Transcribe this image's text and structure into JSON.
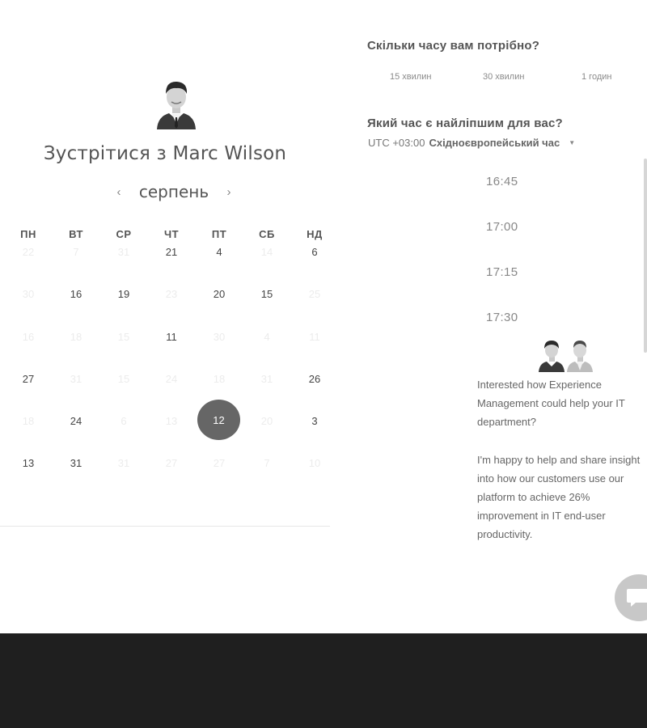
{
  "calendar": {
    "title": "Зустрітися з Marc Wilson",
    "month": "серпень",
    "prev_icon": "chevron-left-icon",
    "next_icon": "chevron-right-icon",
    "weekdays": [
      "ПН",
      "ВТ",
      "СР",
      "ЧТ",
      "ПТ",
      "СБ",
      "НД"
    ],
    "selected_day": "12",
    "rows": [
      [
        {
          "t": "22",
          "a": false
        },
        {
          "t": "7",
          "a": false
        },
        {
          "t": "31",
          "a": false
        },
        {
          "t": "21",
          "a": true
        },
        {
          "t": "4",
          "a": true
        },
        {
          "t": "14",
          "a": false
        },
        {
          "t": "6",
          "a": true
        }
      ],
      [
        {
          "t": "30",
          "a": false
        },
        {
          "t": "16",
          "a": true
        },
        {
          "t": "19",
          "a": true
        },
        {
          "t": "23",
          "a": false
        },
        {
          "t": "20",
          "a": true
        },
        {
          "t": "15",
          "a": true
        },
        {
          "t": "25",
          "a": false
        }
      ],
      [
        {
          "t": "16",
          "a": false
        },
        {
          "t": "18",
          "a": false
        },
        {
          "t": "15",
          "a": false
        },
        {
          "t": "11",
          "a": true
        },
        {
          "t": "30",
          "a": false
        },
        {
          "t": "4",
          "a": false
        },
        {
          "t": "11",
          "a": false
        }
      ],
      [
        {
          "t": "27",
          "a": true
        },
        {
          "t": "31",
          "a": false
        },
        {
          "t": "15",
          "a": false
        },
        {
          "t": "24",
          "a": false
        },
        {
          "t": "18",
          "a": false
        },
        {
          "t": "31",
          "a": false
        },
        {
          "t": "26",
          "a": true
        }
      ],
      [
        {
          "t": "18",
          "a": false
        },
        {
          "t": "24",
          "a": true
        },
        {
          "t": "6",
          "a": false
        },
        {
          "t": "13",
          "a": false
        },
        {
          "t": "12",
          "a": true,
          "sel": true
        },
        {
          "t": "20",
          "a": false
        },
        {
          "t": "3",
          "a": true
        }
      ],
      [
        {
          "t": "13",
          "a": true
        },
        {
          "t": "31",
          "a": true
        },
        {
          "t": "31",
          "a": false
        },
        {
          "t": "27",
          "a": false
        },
        {
          "t": "27",
          "a": false
        },
        {
          "t": "7",
          "a": false
        },
        {
          "t": "10",
          "a": false
        }
      ]
    ]
  },
  "duration": {
    "question": "Скільки часу вам потрібно?",
    "options": [
      "15 хвилин",
      "30 хвилин",
      "1 годин"
    ]
  },
  "time": {
    "question": "Який час є найліпшим для вас?",
    "tz_offset": "UTC +03:00",
    "tz_name": "Східноєвропейський час",
    "slots": [
      "16:45",
      "17:00",
      "17:15",
      "17:30"
    ]
  },
  "description": {
    "p1": "Interested how Experience Management could help your IT department?",
    "p2": "I'm happy to help and share insight into how our customers use our platform to achieve 26% improvement in IT end-user productivity."
  },
  "colors": {
    "selected_day": "#666666",
    "footer": "#1f1f1f",
    "chat_button": "#c8c8c8"
  }
}
